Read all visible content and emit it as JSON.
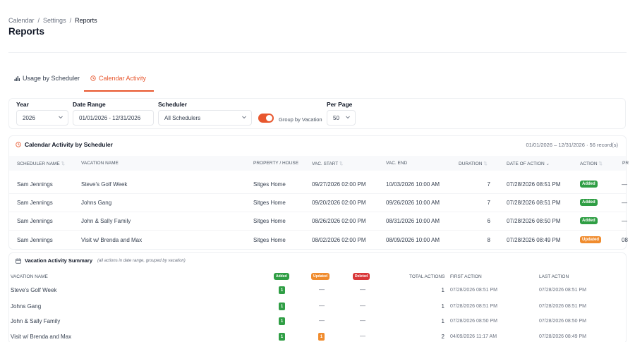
{
  "breadcrumb": {
    "items": [
      "Calendar",
      "Settings",
      "Reports"
    ],
    "sep": "/"
  },
  "page_title": "Reports",
  "tabs": [
    {
      "label": "Usage by Scheduler",
      "icon": "bar-chart-icon",
      "active": false
    },
    {
      "label": "Calendar Activity",
      "icon": "clock-icon",
      "active": true
    }
  ],
  "filters": {
    "year": {
      "label": "Year",
      "value": "2026"
    },
    "date_range": {
      "label": "Date Range",
      "value": "01/01/2026 - 12/31/2026"
    },
    "scheduler": {
      "label": "Scheduler",
      "value": "All Schedulers"
    },
    "group_by_vacation": {
      "label": "Group by Vacation",
      "on": true
    },
    "per_page": {
      "label": "Per Page",
      "value": "50"
    }
  },
  "activity_table": {
    "title": "Calendar Activity by Scheduler",
    "meta": "01/01/2026 – 12/31/2026 · 56 record(s)",
    "columns": [
      "Scheduler Name",
      "Vacation Name",
      "Property / House",
      "Vac. Start",
      "Vac. End",
      "Duration",
      "Date of Action",
      "Action",
      "Pr"
    ],
    "rows": [
      {
        "scheduler": "Sam Jennings",
        "vacation": "Steve's Golf Week",
        "property": "Sitges Home",
        "start": "09/27/2026 02:00 PM",
        "end": "10/03/2026 10:00 AM",
        "duration": "7",
        "date_of_action": "07/28/2026 08:51 PM",
        "action": "Added",
        "extra": "—"
      },
      {
        "scheduler": "Sam Jennings",
        "vacation": "Johns Gang",
        "property": "Sitges Home",
        "start": "09/20/2026 02:00 PM",
        "end": "09/26/2026 10:00 AM",
        "duration": "7",
        "date_of_action": "07/28/2026 08:51 PM",
        "action": "Added",
        "extra": "—"
      },
      {
        "scheduler": "Sam Jennings",
        "vacation": "John & Sally Family",
        "property": "Sitges Home",
        "start": "08/26/2026 02:00 PM",
        "end": "08/31/2026 10:00 AM",
        "duration": "6",
        "date_of_action": "07/28/2026 08:50 PM",
        "action": "Added",
        "extra": "—"
      },
      {
        "scheduler": "Sam Jennings",
        "vacation": "Visit w/ Brenda and Max",
        "property": "Sitges Home",
        "start": "08/02/2026 02:00 PM",
        "end": "08/09/2026 10:00 AM",
        "duration": "8",
        "date_of_action": "07/28/2026 08:49 PM",
        "action": "Updated",
        "extra": "08"
      }
    ]
  },
  "summary": {
    "title": "Vacation Activity Summary",
    "subtitle": "(all actions in date range, grouped by vacation)",
    "columns": {
      "vacation_name": "Vacation Name",
      "added": "Added",
      "updated": "Updated",
      "deleted": "Deleted",
      "total": "Total Actions",
      "first": "First Action",
      "last": "Last Action"
    },
    "rows": [
      {
        "name": "Steve's Golf Week",
        "added": "1",
        "updated": "—",
        "deleted": "—",
        "total": "1",
        "first": "07/28/2026 08:51 PM",
        "last": "07/28/2026 08:51 PM"
      },
      {
        "name": "Johns Gang",
        "added": "1",
        "updated": "—",
        "deleted": "—",
        "total": "1",
        "first": "07/28/2026 08:51 PM",
        "last": "07/28/2026 08:51 PM"
      },
      {
        "name": "John & Sally Family",
        "added": "1",
        "updated": "—",
        "deleted": "—",
        "total": "1",
        "first": "07/28/2026 08:50 PM",
        "last": "07/28/2026 08:50 PM"
      },
      {
        "name": "Visit w/ Brenda and Max",
        "added": "1",
        "updated": "1",
        "deleted": "—",
        "total": "2",
        "first": "04/09/2026 11:17 AM",
        "last": "07/28/2026 08:49 PM"
      }
    ]
  },
  "colors": {
    "accent": "#e8572e",
    "added": "#2f9e44",
    "updated": "#f08c2e",
    "deleted": "#d9383a"
  }
}
